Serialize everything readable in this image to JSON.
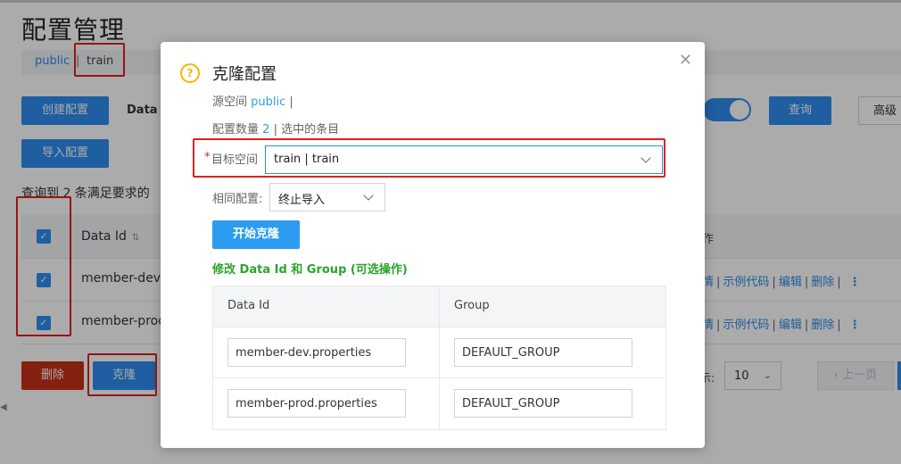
{
  "page": {
    "title": "配置管理",
    "namespaces": {
      "public": "public",
      "separator": "|",
      "train": "train"
    },
    "buttons": {
      "create": "创建配置",
      "import": "导入配置",
      "query": "查询",
      "advanced": "高级",
      "delete": "删除",
      "clone": "克隆"
    },
    "filter_label": "Data I",
    "result_text": "查询到 2 条满足要求的",
    "table": {
      "header": {
        "data_id": "Data Id",
        "ops_fragment": "作"
      },
      "rows": [
        {
          "data_id": "member-dev.p",
          "ops": [
            "情",
            "示例代码",
            "编辑",
            "删除"
          ]
        },
        {
          "data_id": "member-prod.",
          "ops": [
            "情",
            "示例代码",
            "编辑",
            "删除"
          ]
        }
      ],
      "ops_separator": "|"
    },
    "pager": {
      "label": "示:",
      "page_size": "10",
      "prev": "上一页"
    }
  },
  "dialog": {
    "title": "克隆配置",
    "source_label": "源空间",
    "source_value": "public",
    "source_suffix": "|",
    "count_label": "配置数量",
    "count_value": "2",
    "count_suffix": "| 选中的条目",
    "target_label": "目标空间",
    "target_value": "train | train",
    "same_label": "相同配置:",
    "same_value": "终止导入",
    "start_button": "开始克隆",
    "modify_hint": "修改 Data Id 和 Group (可选操作)",
    "table": {
      "headers": [
        "Data Id",
        "Group"
      ],
      "rows": [
        {
          "data_id": "member-dev.properties",
          "group": "DEFAULT_GROUP"
        },
        {
          "data_id": "member-prod.properties",
          "group": "DEFAULT_GROUP"
        }
      ]
    }
  },
  "colors": {
    "primary": "#2d8cf0",
    "danger": "#c7301a",
    "highlight": "#e02020",
    "success": "#2aa52a",
    "warning": "#f5b800"
  },
  "icons": {
    "close": "close-icon",
    "question": "question-icon",
    "chevron": "chevron-down-icon",
    "sort": "sort-icon",
    "more": "more-vertical-icon",
    "checkbox": "checkbox-checked-icon"
  }
}
